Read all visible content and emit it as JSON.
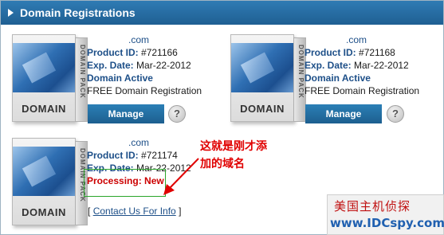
{
  "panel": {
    "title": "Domain Registrations"
  },
  "product_image": {
    "label": "DOMAIN",
    "side_text": "DOMAIN PACK"
  },
  "products": [
    {
      "domain": ".com",
      "product_id_label": "Product ID:",
      "product_id": "#721166",
      "exp_label": "Exp. Date:",
      "exp_date": "Mar-22-2012",
      "status": "Domain Active",
      "type": "FREE Domain Registration",
      "manage_label": "Manage",
      "help_label": "?"
    },
    {
      "domain": ".com",
      "product_id_label": "Product ID:",
      "product_id": "#721168",
      "exp_label": "Exp. Date:",
      "exp_date": "Mar-22-2012",
      "status": "Domain Active",
      "type": "FREE Domain Registration",
      "manage_label": "Manage",
      "help_label": "?"
    },
    {
      "domain": ".com",
      "product_id_label": "Product ID:",
      "product_id": "#721174",
      "exp_label": "Exp. Date:",
      "exp_date": "Mar-22-2012",
      "status": "Processing: New",
      "contact_prefix": "[",
      "contact_label": "Contact Us For Info",
      "contact_suffix": "]"
    }
  ],
  "annotation": {
    "line1": "这就是刚才添",
    "line2": "加的域名",
    "color": "#e00000"
  },
  "watermark": {
    "line1": "美国主机侦探",
    "line2": "www.IDCspy.com"
  },
  "colors": {
    "header": "#2b72ad",
    "link": "#1d4f88",
    "processing": "#cc0000",
    "highlight_box": "#2aa52a"
  }
}
